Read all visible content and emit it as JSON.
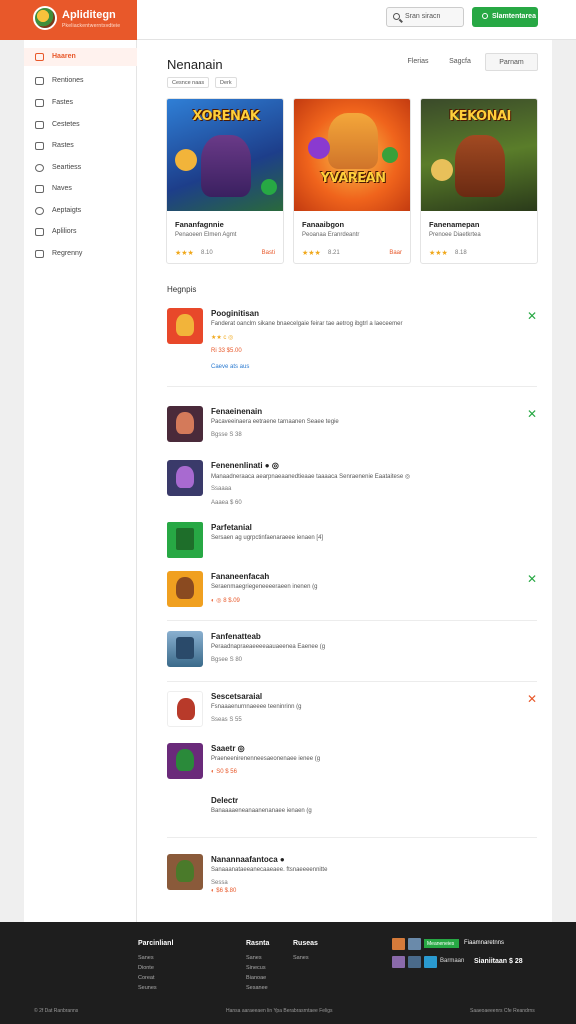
{
  "brand": {
    "name": "Apliditegn",
    "tagline": "Pkeliackentwerntsvdteie"
  },
  "search": {
    "placeholder": "Sran siracn"
  },
  "header": {
    "cta_label": "Slamtentarea"
  },
  "sidebar": {
    "items": [
      {
        "label": "Haaren",
        "icon": "home-icon",
        "active": true
      },
      {
        "label": "Rentiones",
        "icon": "list-icon"
      },
      {
        "label": "Fastes",
        "icon": "folder-icon"
      },
      {
        "label": "Cestetes",
        "icon": "tag-icon"
      },
      {
        "label": "Rastes",
        "icon": "grid-icon"
      },
      {
        "label": "Seartiess",
        "icon": "clock-icon"
      },
      {
        "label": "Naves",
        "icon": "mail-icon"
      },
      {
        "label": "Aeptaigts",
        "icon": "circle-icon"
      },
      {
        "label": "Apliliors",
        "icon": "doc-icon"
      },
      {
        "label": "Regrenny",
        "icon": "calendar-icon"
      }
    ]
  },
  "page": {
    "title": "Nenanain",
    "tabs": [
      "Flerias",
      "Sagcfa",
      "Parnam"
    ],
    "crumbs": [
      "Cesnce naas",
      "Derk"
    ],
    "section_label": "Hegnpis"
  },
  "featured": [
    {
      "banner": "XORENAK",
      "title": "Fananfagnnie",
      "sub": "Penaoeen   Elmen Agmt",
      "stars": "★★★",
      "rating": "8.10",
      "price": "Basti",
      "colors": [
        "#2f7fd6",
        "#6a3a88",
        "#f2b43a"
      ]
    },
    {
      "banner": "YVAREAN",
      "title": "Fanaaibgon",
      "sub": "Peoanaa   Eranrdeantr",
      "stars": "★★★",
      "rating": "8.21",
      "price": "Baar",
      "colors": [
        "#f56a1c",
        "#f4a73a",
        "#8a3ad0"
      ]
    },
    {
      "banner": "KEKONAI",
      "title": "Fanenamepan",
      "sub": "Prenoee   Diaetkrtea",
      "stars": "★★★",
      "rating": "8.18",
      "price": "",
      "colors": [
        "#5a7d2a",
        "#a24a22",
        "#e8c05a"
      ]
    }
  ],
  "apps": [
    {
      "name": "Pooginitisan",
      "desc": "Fanderat oanclm sikane bnaecelgaie feirar tae aetrog ibgtrl a laeceemer",
      "meta": "★★ c ◎",
      "meta2": "Ri 33 $5.00",
      "extra": "Caeve ats aus",
      "action": "✕",
      "action_color": "green",
      "icon_bg": "#e8482a",
      "face": "#f2b43a"
    },
    {
      "name": "Fenaeinenain",
      "desc": "Pacaveeinaera eetraene tarnaanen Seaee tegie",
      "meta": "Bgsse   S 38",
      "meta2": "",
      "extra": "",
      "action": "✕",
      "action_color": "green",
      "icon_bg": "#4a2a3a",
      "face": "#d47a5a"
    },
    {
      "name": "Fenenenlinati ● ◎",
      "desc": "Manaadneraaca aearpnaeaanedtieaae taaaaca Senraenenie Eaataitese ◎",
      "meta": "Ssaaaa",
      "meta2": "Aaaea   $ 60",
      "extra": "",
      "action": "",
      "action_color": "",
      "icon_bg": "#3a3a6a",
      "face": "#a86ad0"
    },
    {
      "name": "Parfetanial",
      "desc": "Sersaen ag ugrpctinfaenaraeee ienaen [4]",
      "meta": "",
      "meta2": "",
      "extra": "",
      "action": "",
      "action_color": "",
      "icon_bg": "#27a844",
      "face": "#1e6e2a"
    },
    {
      "name": "Fananeenfacah",
      "desc": "Seraenmaegriegeneeeeraeen inenen (g",
      "meta": "◐  ◎ 8 $.09",
      "meta2": "",
      "extra": "",
      "action": "✕",
      "action_color": "green",
      "icon_bg": "#f0a020",
      "face": "#8a4a20"
    },
    {
      "name": "Fanfenatteab",
      "desc": "Peraadnapraeaeeeeaauaeenea Eaenee (g",
      "meta": "Bgsee   S 80",
      "meta2": "",
      "extra": "",
      "action": "",
      "action_color": "",
      "icon_bg": "#5a8aaa",
      "face": "#2a4a6a"
    },
    {
      "name": "Sescetsaraial",
      "desc": "Fsnaaaenurnnaeeee teeninrinn (g",
      "meta": "Sseas   S 55",
      "meta2": "",
      "extra": "",
      "action": "✕",
      "action_color": "orange",
      "icon_bg": "#ffffff",
      "face": "#b83a2a"
    },
    {
      "name": "Saaetr ◎",
      "desc": "Praeneenirenenneesaeonenaee ienee (g",
      "meta": "◐  S0 $ 56",
      "meta2": "",
      "extra": "",
      "action": "",
      "action_color": "",
      "icon_bg": "#6a2a7a",
      "face": "#2a8a3a"
    },
    {
      "name": "Delectr",
      "desc": "Banaaaaeneanaanenanaee ienaen (g",
      "meta": "",
      "meta2": "",
      "extra": "",
      "action": "",
      "action_color": "",
      "icon_bg": "#ffffff",
      "face": "#ffffff"
    },
    {
      "name": "Nanannaafantoca ●",
      "desc": "Sanaaanataeeanecaaeaee. ftsnaeeeennitte",
      "meta": "Sessa",
      "meta2": "◐  $6 $.80",
      "extra": "",
      "action": "",
      "action_color": "",
      "icon_bg": "#8a5a3a",
      "face": "#4a7a2a"
    }
  ],
  "footer": {
    "cols": [
      {
        "heading": "Parcinlianl",
        "links": [
          "Sanes",
          "Dionte",
          "Coreat",
          "Seunes"
        ]
      },
      {
        "heading": "Rasnta",
        "links": [
          "Sanes",
          "Sinecus",
          "Bianoae",
          "Sesanee"
        ]
      },
      {
        "heading": "Ruseas",
        "links": [
          "Sanes"
        ]
      }
    ],
    "store_badge": "Meaneneies",
    "store_label": "Fiaamnaretnns",
    "store_label2": "Barmaan",
    "store_label3": "Sianiitaan $ 28",
    "bottom_left": "© 2f Dat Ranbranns",
    "bottom_center": "Hansa aaraeeaen lin Ypa Berabrasrntaee Feligs",
    "bottom_right": "Saaeoaeeenrs Cfe Reandrns"
  },
  "colors": {
    "accent": "#e8582a",
    "green": "#27a844",
    "footer": "#1e1e1e"
  }
}
